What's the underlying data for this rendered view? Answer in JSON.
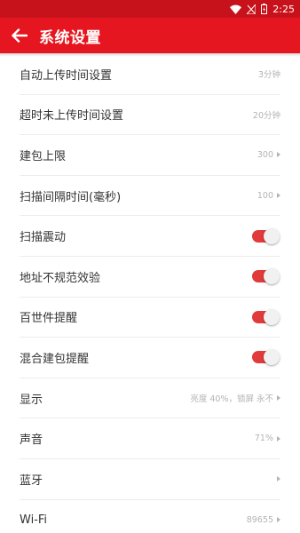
{
  "status_bar": {
    "time": "2:25",
    "icons": [
      "wifi-icon",
      "signal-off-icon",
      "battery-icon"
    ]
  },
  "header": {
    "title": "系统设置",
    "back_icon": "arrow-left-icon"
  },
  "colors": {
    "status_bar": "#c8121b",
    "app_bar": "#e5161f",
    "toggle_on": "#e03a3a"
  },
  "settings": [
    {
      "label": "自动上传时间设置",
      "value": "3分钟",
      "type": "value"
    },
    {
      "label": "超时未上传时间设置",
      "value": "20分钟",
      "type": "value"
    },
    {
      "label": "建包上限",
      "value": "300",
      "type": "nav"
    },
    {
      "label": "扫描间隔时间(毫秒)",
      "value": "100",
      "type": "nav"
    },
    {
      "label": "扫描震动",
      "type": "toggle",
      "on": true
    },
    {
      "label": "地址不规范效验",
      "type": "toggle",
      "on": true
    },
    {
      "label": "百世件提醒",
      "type": "toggle",
      "on": true
    },
    {
      "label": "混合建包提醒",
      "type": "toggle",
      "on": true
    },
    {
      "label": "显示",
      "value": "亮度 40%，锁屏 永不",
      "type": "nav"
    },
    {
      "label": "声音",
      "value": "71%",
      "type": "nav"
    },
    {
      "label": "蓝牙",
      "value": "",
      "type": "nav"
    },
    {
      "label": "Wi-Fi",
      "value": "89655",
      "type": "nav"
    }
  ]
}
